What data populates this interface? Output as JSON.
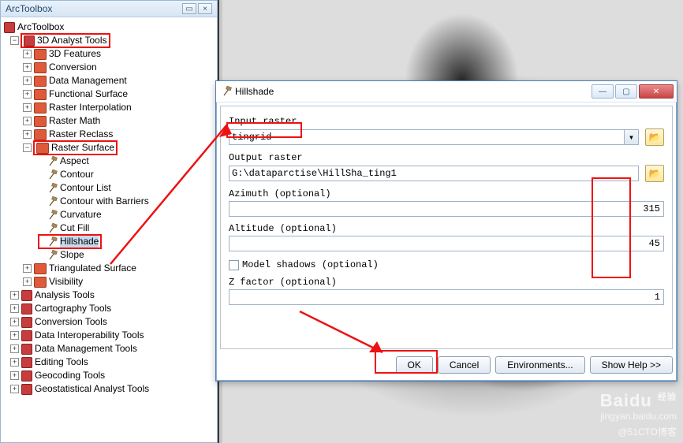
{
  "panel": {
    "title": "ArcToolbox",
    "root": "ArcToolbox",
    "folders": [
      "3D Analyst Tools",
      "Analysis Tools",
      "Cartography Tools",
      "Conversion Tools",
      "Data Interoperability Tools",
      "Data Management Tools",
      "Editing Tools",
      "Geocoding Tools",
      "Geostatistical Analyst Tools"
    ],
    "l2": [
      "3D Features",
      "Conversion",
      "Data Management",
      "Functional Surface",
      "Raster Interpolation",
      "Raster Math",
      "Raster Reclass",
      "Raster Surface",
      "Triangulated Surface",
      "Visibility"
    ],
    "surface_tools": [
      "Aspect",
      "Contour",
      "Contour List",
      "Contour with Barriers",
      "Curvature",
      "Cut Fill",
      "Hillshade",
      "Slope"
    ]
  },
  "dialog": {
    "title": "Hillshade",
    "labels": {
      "input": "Input raster",
      "output": "Output raster",
      "azimuth": "Azimuth (optional)",
      "altitude": "Altitude (optional)",
      "model_shadows": "Model shadows (optional)",
      "zfactor": "Z factor (optional)"
    },
    "values": {
      "input": "tingrid",
      "output": "G:\\dataparctise\\HillSha_ting1",
      "azimuth": "315",
      "altitude": "45",
      "zfactor": "1"
    },
    "buttons": {
      "ok": "OK",
      "cancel": "Cancel",
      "env": "Environments...",
      "help": "Show Help >>"
    }
  },
  "watermark": {
    "brand": "Baidu",
    "sub": "经验",
    "site": "jingyan.baidu.com",
    "credit": "@51CTO博客"
  }
}
